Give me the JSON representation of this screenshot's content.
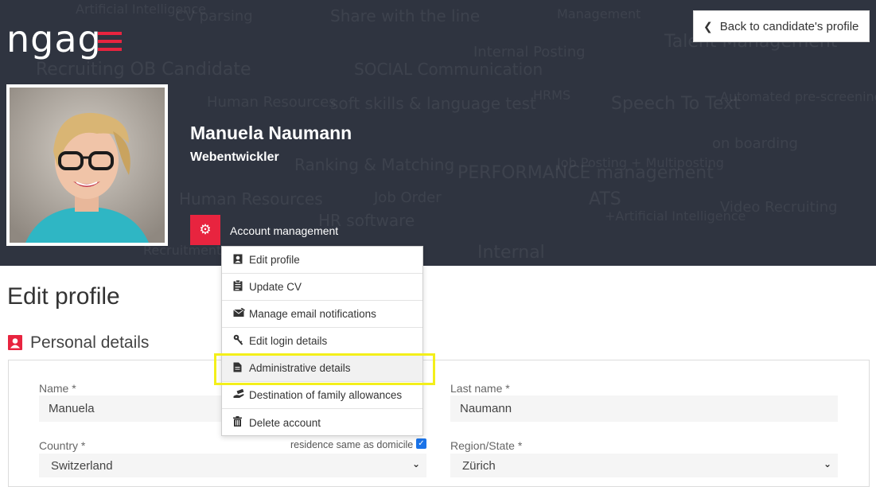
{
  "header": {
    "logo_text": "ngag",
    "back_button_label": "Back to candidate's profile",
    "background_words": [
      "Artificial Intelligence",
      "CV parsing",
      "Share with the line",
      "Recruiting OB Candidate",
      "Management",
      "Internal Posting",
      "SOCIAL Communication",
      "Talent Management",
      "HRMS",
      "Human Resources",
      "soft skills & language test",
      "Speech To Text",
      "Automated pre-screening",
      "on boarding",
      "Ranking & Matching",
      "PERFORMANCE management",
      "Job Posting + Multiposting",
      "Job Order",
      "Human Resources",
      "ATS",
      "+Artificial Intelligence",
      "Video Recruiting",
      "HR software",
      "Internal",
      "Recruitment"
    ]
  },
  "candidate": {
    "name": "Manuela Naumann",
    "title": "Webentwickler"
  },
  "account_menu": {
    "label": "Account management",
    "items": [
      {
        "label": "Edit profile",
        "icon": "id-card-icon"
      },
      {
        "label": "Update CV",
        "icon": "clipboard-icon"
      },
      {
        "label": "Manage email notifications",
        "icon": "envelope-icon"
      },
      {
        "label": "Edit login details",
        "icon": "key-icon"
      },
      {
        "label": "Administrative details",
        "icon": "document-icon"
      },
      {
        "label": "Destination of family allowances",
        "icon": "hand-money-icon"
      },
      {
        "label": "Delete account",
        "icon": "trash-icon"
      }
    ]
  },
  "main": {
    "page_title": "Edit profile",
    "section_title": "Personal details",
    "fields": {
      "name_label": "Name *",
      "name_value": "Manuela",
      "last_name_label": "Last name *",
      "last_name_value": "Naumann",
      "country_label": "Country *",
      "country_value": "Switzerland",
      "residence_label": "residence same as domicile",
      "region_label": "Region/State *",
      "region_value": "Zürich"
    }
  },
  "colors": {
    "banner": "#2f3440",
    "accent": "#e8243f",
    "highlight": "#f3ef1a"
  }
}
